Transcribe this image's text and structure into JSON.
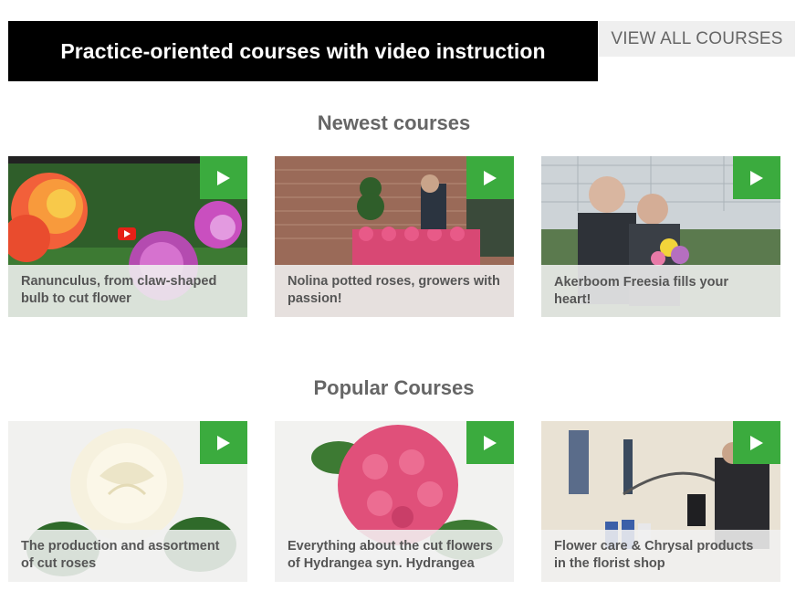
{
  "header": {
    "title": "Practice-oriented courses with video instruction",
    "view_all_label": "VIEW ALL COURSES"
  },
  "colors": {
    "banner_bg": "#000000",
    "accent_green": "#3bab3e",
    "caption_text": "#555555",
    "section_title": "#666666"
  },
  "sections": [
    {
      "title": "Newest courses",
      "courses": [
        {
          "title": "Ranunculus, from claw-shaped bulb to cut flower",
          "icon": "play-icon"
        },
        {
          "title": "Nolina potted roses, growers with passion!",
          "icon": "play-icon"
        },
        {
          "title": "Akerboom Freesia fills your heart!",
          "icon": "play-icon"
        }
      ]
    },
    {
      "title": "Popular Courses",
      "courses": [
        {
          "title": "The production and assortment of cut roses",
          "icon": "play-icon"
        },
        {
          "title": "Everything about the cut flowers of Hydrangea syn. Hydrangea",
          "icon": "play-icon"
        },
        {
          "title": "Flower care & Chrysal products in the florist shop",
          "icon": "play-icon"
        }
      ]
    }
  ]
}
